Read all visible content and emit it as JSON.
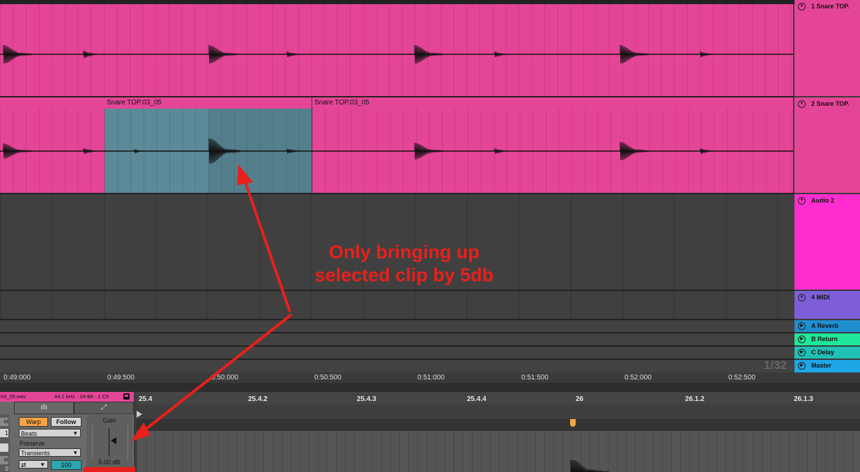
{
  "tracks": [
    {
      "name": "1 Snare TOP.",
      "color": "#e54597"
    },
    {
      "name": "2 Snare TOP.",
      "color": "#e54597"
    },
    {
      "name": "Audio 2",
      "color": "#ff2dd0"
    },
    {
      "name": "4 MIDI",
      "color": "#7e5ed8"
    }
  ],
  "returns": [
    {
      "name": "A Reverb",
      "color": "#1f8fd0"
    },
    {
      "name": "B Return",
      "color": "#1fe89a"
    },
    {
      "name": "C Delay",
      "color": "#1fc0b5"
    },
    {
      "name": "Master",
      "color": "#1fa6e6"
    }
  ],
  "clips": {
    "clip_a_name": "Snare TOP.03_05",
    "clip_b_name": "Snare TOP.03_05"
  },
  "timeline": {
    "ticks": [
      "0:49:000",
      "0:49:500",
      "0:50:000",
      "0:50:500",
      "0:51:000",
      "0:51:500",
      "0:52:000",
      "0:52:500"
    ],
    "page_counter": "1/32"
  },
  "annotation": {
    "line1": "Only bringing up",
    "line2": "selected clip by 5db",
    "color": "#e8201c"
  },
  "clip_view": {
    "file_label": "03_05.wav",
    "file_info": "44.1 kHz · 24-Bit · 1 Ch",
    "warp_label": "Warp",
    "follow_label": "Follow",
    "warp_mode": "Beats",
    "preserve_label": "Preserve",
    "preserve_value": "Transients",
    "envelope_value": "100",
    "gain_label": "Gain",
    "gain_value": "5.00 dB",
    "left_fragments": [
      "et",
      "1",
      "et",
      "0"
    ],
    "sample_ruler": [
      "25.4",
      "25.4.2",
      "25.4.3",
      "25.4.4",
      "26",
      "26.1.2",
      "26.1.3"
    ]
  }
}
